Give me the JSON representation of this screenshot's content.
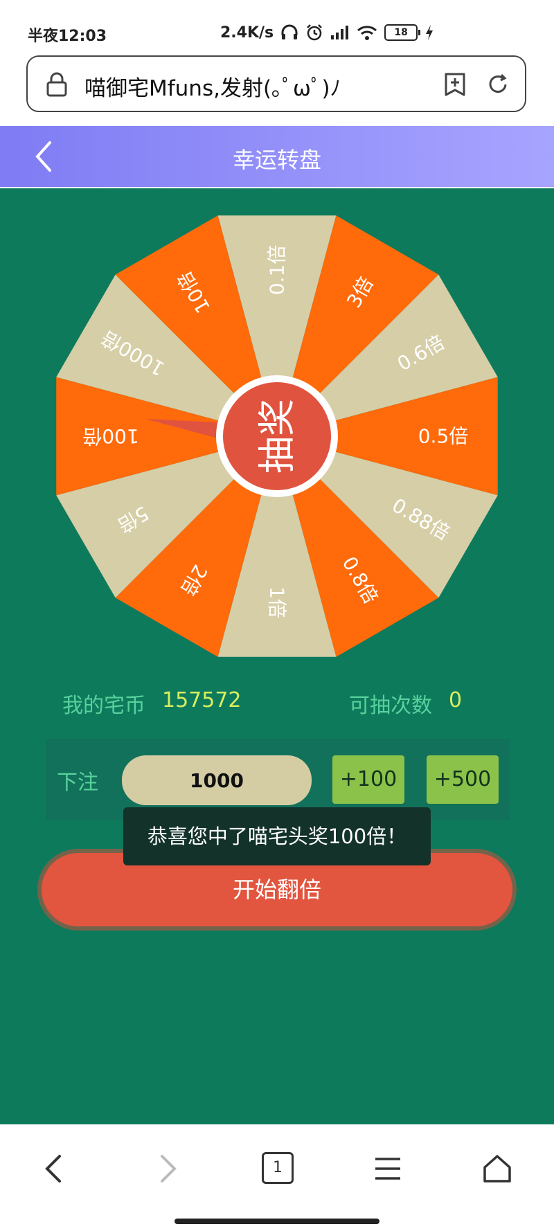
{
  "status_bar": {
    "time": "半夜12:03",
    "net_speed": "2.4K/s",
    "battery": "18"
  },
  "browser": {
    "url_text": "喵御宅Mfuns,发射(｡ﾟωﾟ)ﾉ"
  },
  "header": {
    "title": "幸运转盘"
  },
  "wheel": {
    "segments": [
      "0.1倍",
      "3倍",
      "0.6倍",
      "0.5倍",
      "0.88倍",
      "0.8倍",
      "1倍",
      "2倍",
      "5倍",
      "100倍",
      "1000倍",
      "10倍"
    ],
    "center_label": "抽奖",
    "colors": {
      "orange": "#ff6a0a",
      "beige": "#d6cea6",
      "center": "#e0533f"
    }
  },
  "stats": {
    "coins_label": "我的宅币",
    "coins_value": "157572",
    "draws_label": "可抽次数",
    "draws_value": "0"
  },
  "bet": {
    "label": "下注",
    "value": "1000",
    "plus100_label": "+100",
    "plus500_label": "+500"
  },
  "toast": "恭喜您中了喵宅头奖100倍！",
  "start_button_label": "开始翻倍",
  "bottom_nav": {
    "tab_count": "1"
  },
  "icons": [
    "lock-icon",
    "bookmark-add-icon",
    "refresh-icon",
    "back-icon",
    "forward-icon",
    "tabs-icon",
    "menu-icon",
    "home-icon",
    "headphone-icon",
    "alarm-icon",
    "signal-icon",
    "wifi-icon",
    "battery-icon",
    "charging-icon"
  ],
  "theme": {
    "background": "#0e7a5c",
    "header_start": "#7f7cf4",
    "header_end": "#a7a4ff",
    "button_green": "#8bc34a"
  }
}
